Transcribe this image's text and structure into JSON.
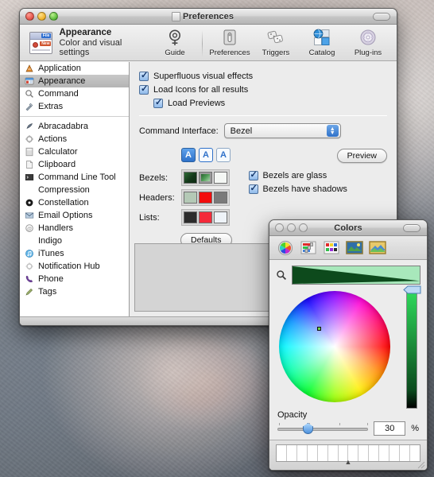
{
  "desktop": {
    "name": "desktop-wallpaper-photo"
  },
  "preferences_window": {
    "title": "Preferences",
    "header": {
      "icon": "appearance-app-icon",
      "icon_tag_top": "File",
      "icon_tag_bottom": "New",
      "title": "Appearance",
      "subtitle": "Color and visual settings"
    },
    "toolbar": [
      {
        "label": "Guide",
        "icon": "guide-target-icon"
      },
      {
        "label": "Preferences",
        "icon": "preferences-switch-icon"
      },
      {
        "label": "Triggers",
        "icon": "triggers-dice-icon"
      },
      {
        "label": "Catalog",
        "icon": "catalog-globe-icon"
      },
      {
        "label": "Plug-ins",
        "icon": "plugins-gear-icon"
      }
    ],
    "toolbar_toggle": "toolbar-pill-button",
    "sidebar": {
      "group_main": [
        {
          "label": "Application",
          "icon": "application-icon",
          "selected": false
        },
        {
          "label": "Appearance",
          "icon": "appearance-icon",
          "selected": true
        },
        {
          "label": "Command",
          "icon": "command-magnifier-icon",
          "selected": false
        },
        {
          "label": "Extras",
          "icon": "extras-tools-icon",
          "selected": false
        }
      ],
      "group_plugins": [
        {
          "label": "Abracadabra",
          "icon": "abracadabra-wand-icon"
        },
        {
          "label": "Actions",
          "icon": "actions-gear-icon"
        },
        {
          "label": "Calculator",
          "icon": "calculator-icon"
        },
        {
          "label": "Clipboard",
          "icon": "clipboard-icon"
        },
        {
          "label": "Command Line Tool",
          "icon": "terminal-icon"
        },
        {
          "label": "Compression",
          "icon": "none-icon"
        },
        {
          "label": "Constellation",
          "icon": "constellation-icon"
        },
        {
          "label": "Email Options",
          "icon": "email-icon"
        },
        {
          "label": "Handlers",
          "icon": "handlers-icon"
        },
        {
          "label": "Indigo",
          "icon": "none-icon"
        },
        {
          "label": "iTunes",
          "icon": "itunes-icon"
        },
        {
          "label": "Notification Hub",
          "icon": "notification-gear-icon"
        },
        {
          "label": "Phone",
          "icon": "phone-icon"
        },
        {
          "label": "Tags",
          "icon": "tags-pen-icon"
        }
      ]
    },
    "pane": {
      "checkboxes": [
        {
          "label": "Superfluous visual effects",
          "checked": true,
          "indent": false
        },
        {
          "label": "Load Icons for all results",
          "checked": true,
          "indent": false
        },
        {
          "label": "Load Previews",
          "checked": true,
          "indent": true
        }
      ],
      "command_interface_label": "Command Interface:",
      "command_interface_value": "Bezel",
      "preview_button": "Preview",
      "defaults_button": "Defaults",
      "font_buttons": [
        {
          "label": "A",
          "state": "selected"
        },
        {
          "label": "A",
          "state": "outlined"
        },
        {
          "label": "A",
          "state": "plain"
        }
      ],
      "swatch_rows": [
        {
          "name": "Bezels:",
          "colors": [
            "#18441f",
            "#3b7a3f",
            "#f4f7f4"
          ],
          "selected_index": 1
        },
        {
          "name": "Headers:",
          "colors": [
            "#b4c9b6",
            "#f20d0d",
            "#7a7a7a"
          ],
          "selected_index": -1
        },
        {
          "name": "Lists:",
          "colors": [
            "#2c2c2c",
            "#f42a3a",
            "#eef3f8"
          ],
          "selected_index": -1
        }
      ],
      "right_checkboxes": [
        {
          "label": "Bezels are glass",
          "checked": true
        },
        {
          "label": "Bezels have shadows",
          "checked": true
        }
      ]
    }
  },
  "colors_panel": {
    "title": "Colors",
    "toolbar": [
      {
        "icon": "color-wheel-icon",
        "label": "Color Wheel"
      },
      {
        "icon": "color-sliders-icon",
        "label": "Color Sliders"
      },
      {
        "icon": "color-palettes-icon",
        "label": "Color Palettes"
      },
      {
        "icon": "image-palettes-icon",
        "label": "Image Palettes"
      },
      {
        "icon": "crayons-icon",
        "label": "Crayons"
      }
    ],
    "search_icon": "magnifier-icon",
    "selected_color_dark": "#0d4a1c",
    "selected_color_light": "#a8e8bb",
    "wheel": {
      "icon": "color-wheel",
      "marker_color": "#6fd34a"
    },
    "brightness_bar": {
      "icon": "brightness-slider",
      "value_top": "#2fdb5c"
    },
    "opacity_label": "Opacity",
    "opacity_value": "30",
    "opacity_unit": "%",
    "swatch_well_count": 14,
    "drawer_caret": "▲"
  }
}
